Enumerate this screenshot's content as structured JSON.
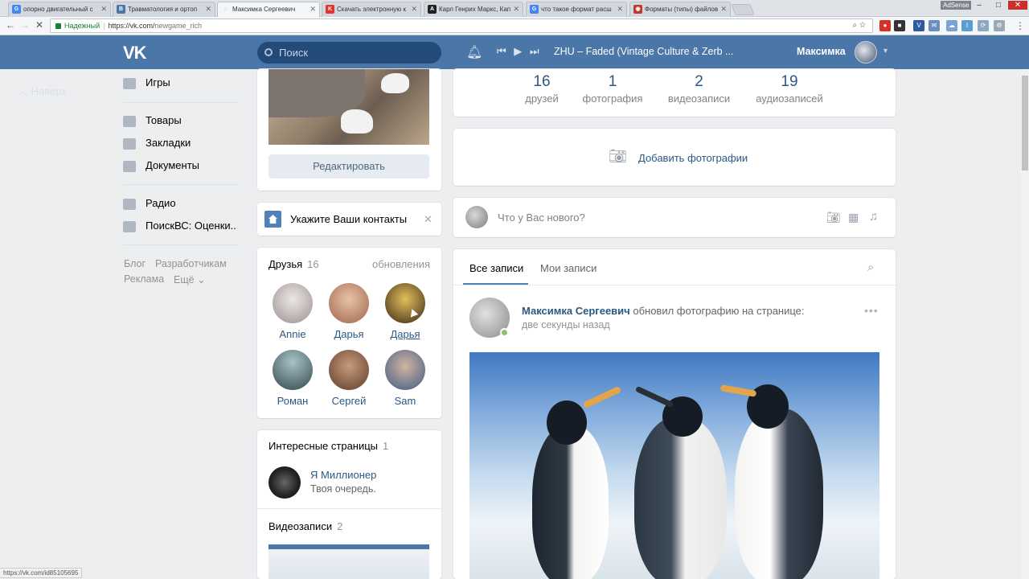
{
  "browser": {
    "tabs": [
      {
        "title": "опорно двигательный с",
        "favicon": "G",
        "color": "#4285f4"
      },
      {
        "title": "Травматология и ортоп",
        "favicon": "В",
        "color": "#4a76a8"
      },
      {
        "title": "Максимка Сергеевич",
        "favicon": "◌",
        "color": "#888888"
      },
      {
        "title": "Скачать электронную к",
        "favicon": "K",
        "color": "#e2342f"
      },
      {
        "title": "Карл Генрих Маркс, Кап",
        "favicon": "A",
        "color": "#222222"
      },
      {
        "title": "что такое формат расш",
        "favicon": "G",
        "color": "#4285f4"
      },
      {
        "title": "Форматы (типы) файлов",
        "favicon": "◉",
        "color": "#c0392b"
      }
    ],
    "adsense_label": "AdSense",
    "url_secure_label": "Надежный",
    "url_domain": "https://vk.com/",
    "url_path": "newgame_rich",
    "status_url": "https://vk.com/id85105695"
  },
  "header": {
    "logo": "VK",
    "search_placeholder": "Поиск",
    "track_title": "ZHU – Faded (Vintage Culture & Zerb ...",
    "user_name": "Максимка"
  },
  "left_nav": {
    "back_label": "Наверх",
    "items": [
      {
        "label": "Игры"
      },
      {
        "label": "Товары"
      },
      {
        "label": "Закладки"
      },
      {
        "label": "Документы"
      },
      {
        "label": "Радио"
      },
      {
        "label": "ПоискВС: Оценки.."
      }
    ],
    "footer": {
      "blog": "Блог",
      "developers": "Разработчикам",
      "ads": "Реклама",
      "more": "Ещё"
    }
  },
  "profile": {
    "edit_label": "Редактировать",
    "contacts_label": "Укажите Ваши контакты",
    "friends": {
      "title": "Друзья",
      "count": "16",
      "updates_label": "обновления",
      "list": [
        {
          "name": "Annie",
          "color": "#c9c3c4"
        },
        {
          "name": "Дарья",
          "color": "#b9876d"
        },
        {
          "name": "Дарья",
          "color": "#6a4b2a"
        },
        {
          "name": "Роман",
          "color": "#4e6b74"
        },
        {
          "name": "Сергей",
          "color": "#7a5a46"
        },
        {
          "name": "Sam",
          "color": "#5b6f8c"
        }
      ]
    },
    "pages": {
      "title": "Интересные страницы",
      "count": "1",
      "item_name": "Я Миллионер",
      "item_desc": "Твоя очередь."
    },
    "videos": {
      "title": "Видеозаписи",
      "count": "2"
    }
  },
  "stats": [
    {
      "value": "16",
      "label": "друзей"
    },
    {
      "value": "1",
      "label": "фотография"
    },
    {
      "value": "2",
      "label": "видеозаписи"
    },
    {
      "value": "19",
      "label": "аудиозаписей"
    }
  ],
  "add_photos_label": "Добавить фотографии",
  "composer_placeholder": "Что у Вас нового?",
  "wall": {
    "tab_all": "Все записи",
    "tab_mine": "Мои записи",
    "post": {
      "author": "Максимка Сергеевич",
      "action": "обновил фотографию на странице:",
      "time": "две секунды назад"
    }
  }
}
